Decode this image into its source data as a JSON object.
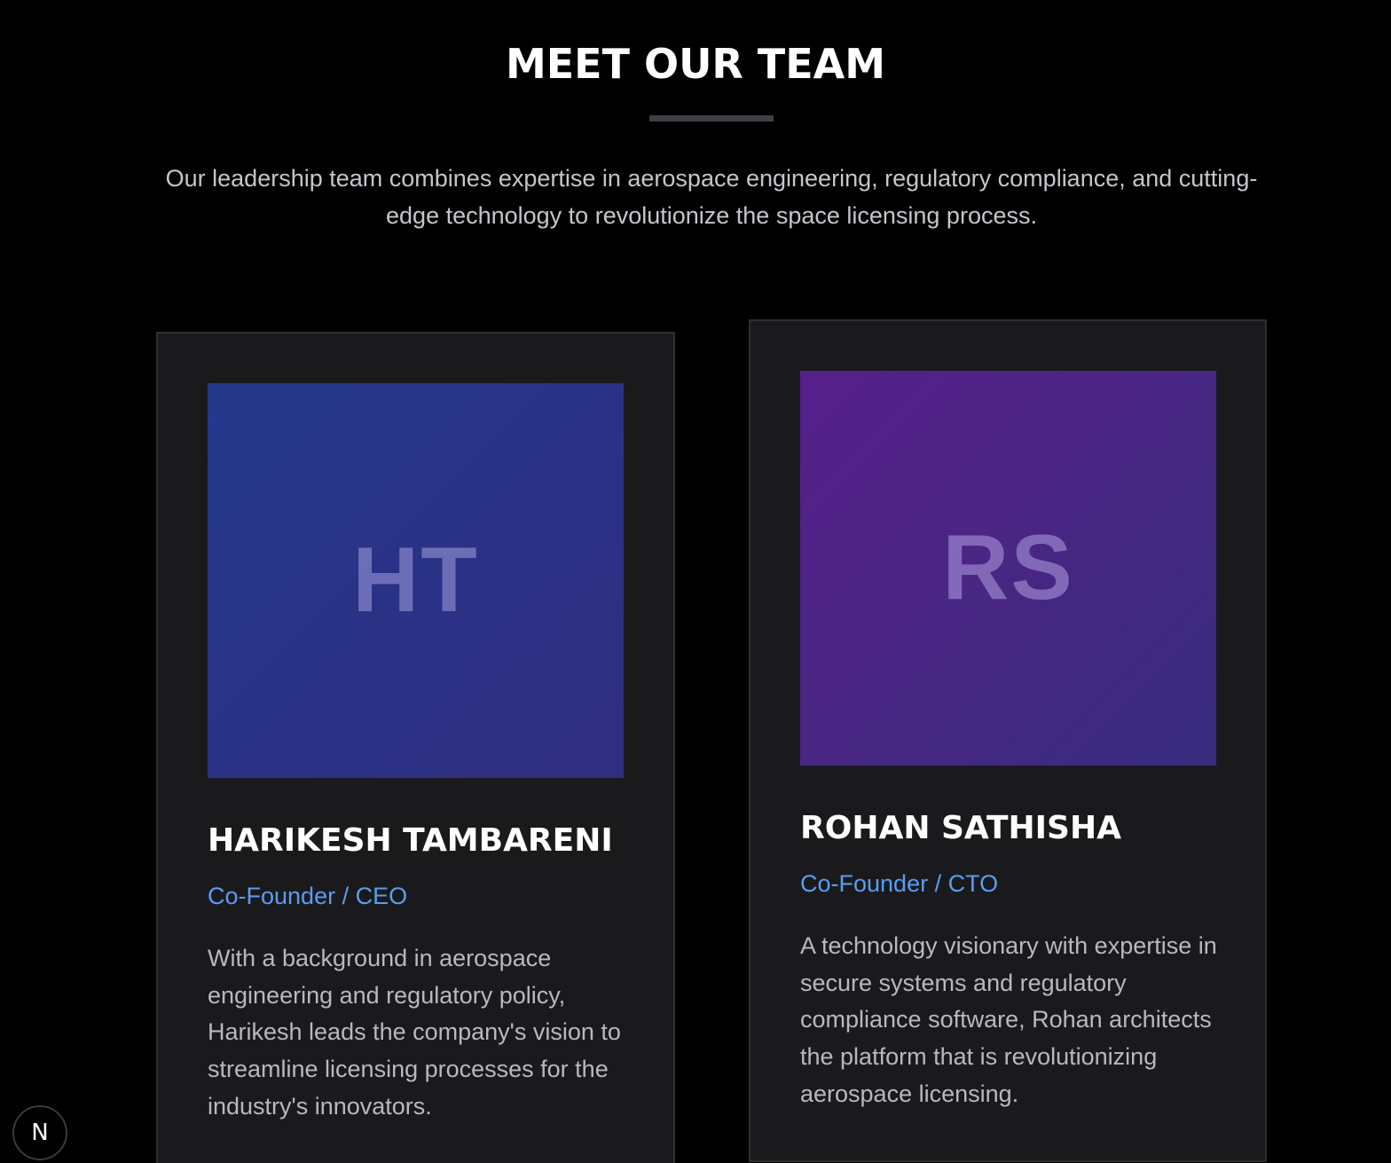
{
  "section": {
    "title": "MEET OUR TEAM",
    "intro": "Our leadership team combines expertise in aerospace engineering, regulatory compliance, and cutting-edge technology to revolutionize the space licensing process."
  },
  "team": [
    {
      "initials": "HT",
      "name": "HARIKESH TAMBARENI",
      "role": "Co-Founder / CEO",
      "bio": "With a background in aerospace engineering and regulatory policy, Harikesh leads the company's vision to streamline licensing processes for the industry's innovators."
    },
    {
      "initials": "RS",
      "name": "ROHAN SATHISHA",
      "role": "Co-Founder / CTO",
      "bio": "A technology visionary with expertise in secure systems and regulatory compliance software, Rohan architects the platform that is revolutionizing aerospace licensing."
    }
  ],
  "dev_badge": {
    "label": "N",
    "icon": "nextjs-logo-icon"
  },
  "colors": {
    "background": "#000000",
    "card": "#1a1a1d",
    "accent": "#5b9cf0",
    "avatar_blue": "#2b3186",
    "avatar_purple": "#482683"
  }
}
